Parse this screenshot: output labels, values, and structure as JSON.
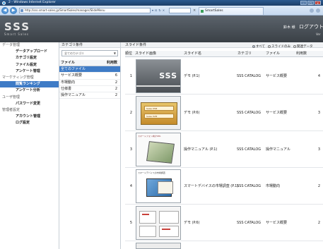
{
  "browser": {
    "title": "2 - Windows Internet Explorer",
    "address": "http://sss.smart-sales.jp/SmartSales/manager/SlideMenu",
    "tab_label": "SmartSales",
    "nav_back": "◀",
    "nav_forward": "▶"
  },
  "header": {
    "logo": "SSS",
    "logo_sub": "Smart Sales",
    "user": "鈴木 様",
    "logout": "ログアウト",
    "sub": "Ver"
  },
  "sidebar": {
    "items": [
      {
        "label": "データ管理",
        "type": "section"
      },
      {
        "label": "データアップロード",
        "type": "sub"
      },
      {
        "label": "カテゴリ設定",
        "type": "sub"
      },
      {
        "label": "ファイル設定",
        "type": "sub"
      },
      {
        "label": "アンケート管理",
        "type": "sub"
      },
      {
        "label": "マーケティング管理",
        "type": "section"
      },
      {
        "label": "閲覧ランキング",
        "type": "sub",
        "active": true
      },
      {
        "label": "アンケート分析",
        "type": "sub"
      },
      {
        "label": "ユーザ管理",
        "type": "section"
      },
      {
        "label": "パスワード変更",
        "type": "sub"
      },
      {
        "label": "管理者設定",
        "type": "section"
      },
      {
        "label": "アカウント管理",
        "type": "sub"
      },
      {
        "label": "ログ設定",
        "type": "sub"
      }
    ]
  },
  "category_panel": {
    "title": "カテゴリ条件",
    "select_value": "全てのカテゴリ",
    "col_file": "ファイル",
    "col_count": "利用数",
    "rows": [
      {
        "name": "全てのファイル",
        "count": "",
        "active": true
      },
      {
        "name": "サービス概要",
        "count": "6"
      },
      {
        "name": "市場動向",
        "count": "2"
      },
      {
        "name": "仕様書",
        "count": "2"
      },
      {
        "name": "操作マニュアル",
        "count": "2"
      }
    ]
  },
  "slide_panel": {
    "title": "スライド条件",
    "filters": [
      "すべて",
      "スライドのみ",
      "関連データ"
    ],
    "columns": {
      "order": "順位",
      "thumb": "スライド画像",
      "name": "スライド名",
      "category": "カテゴリ",
      "file": "ファイル",
      "usage": "利用数"
    },
    "rows": [
      {
        "rank": "1",
        "name": "デモ (P.1)",
        "category": "SSS CATALOG",
        "file": "サービス概要",
        "usage": "4"
      },
      {
        "rank": "2",
        "name": "デモ (P.6)",
        "category": "SSS CATALOG",
        "file": "サービス概要",
        "usage": "3"
      },
      {
        "rank": "3",
        "name": "操作マニュアル (P.1)",
        "category": "SSS CATALOG",
        "file": "操作マニュアル",
        "usage": "3"
      },
      {
        "rank": "4",
        "name": "スマートデバイスの市場調査 (P.1)",
        "category": "SSS CATALOG",
        "file": "市場動向",
        "usage": "2"
      },
      {
        "rank": "5",
        "name": "デモ (P.6)",
        "category": "SSS CATALOG",
        "file": "サービス概要",
        "usage": "2"
      }
    ],
    "thumb_texts": {
      "t1_logo": "SSS",
      "t2_tag1": "Sales ¥5M",
      "t2_tag2": "Sales ¥2M",
      "t3_header": "スマートフォン向けSFA",
      "t4_header": "スマートデバイスの市場調査"
    }
  },
  "colors": {
    "accent": "#3e7bc6",
    "header_bg": "#4a5057",
    "ie_title": "#2b5a8f"
  }
}
